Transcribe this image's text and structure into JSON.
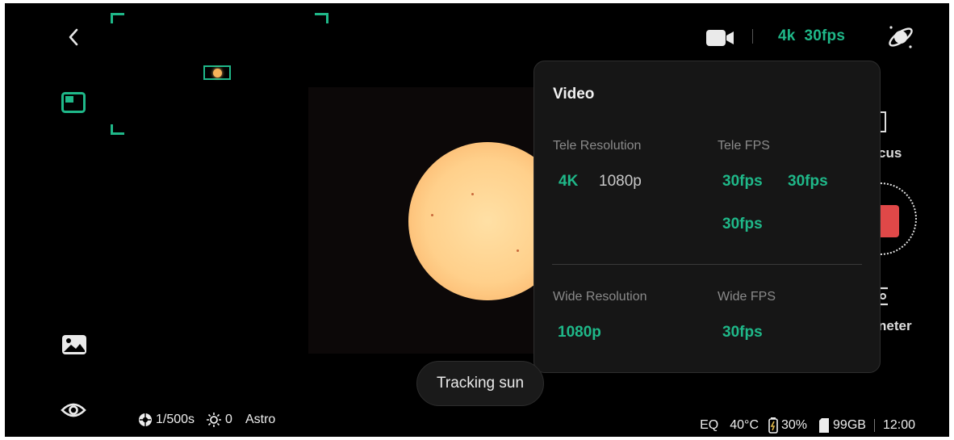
{
  "top_bar": {
    "back_icon": "chevron-left-icon",
    "camera_mode_icon": "video-camera-icon",
    "resolution_summary": "4k  30fps",
    "sky_icon": "planet-icon"
  },
  "left_rail": {
    "layout_icon": "preview-layout-icon",
    "gallery_icon": "gallery-icon",
    "visibility_icon": "eye-icon"
  },
  "right_rail": {
    "focus_label": "cus",
    "meter_label": "neter"
  },
  "video_panel": {
    "title": "Video",
    "tele_resolution": {
      "label": "Tele Resolution",
      "options": [
        "4K",
        "1080p"
      ],
      "selected": "4K"
    },
    "tele_fps": {
      "label": "Tele FPS",
      "options": [
        "30fps",
        "30fps",
        "30fps"
      ]
    },
    "wide_resolution": {
      "label": "Wide Resolution",
      "options": [
        "1080p"
      ],
      "selected": "1080p"
    },
    "wide_fps": {
      "label": "Wide FPS",
      "options": [
        "30fps"
      ],
      "selected": "30fps"
    }
  },
  "toast": {
    "text": "Tracking sun"
  },
  "bottom_left": {
    "shutter": "1/500s",
    "exposure": "0",
    "mode": "Astro"
  },
  "bottom_right": {
    "mount_mode": "EQ",
    "temperature": "40°C",
    "battery": "30%",
    "storage": "99GB",
    "time": "12:00"
  },
  "colors": {
    "accent": "#1fb889",
    "background": "#000000",
    "panel": "#161616",
    "record": "#e04848"
  }
}
